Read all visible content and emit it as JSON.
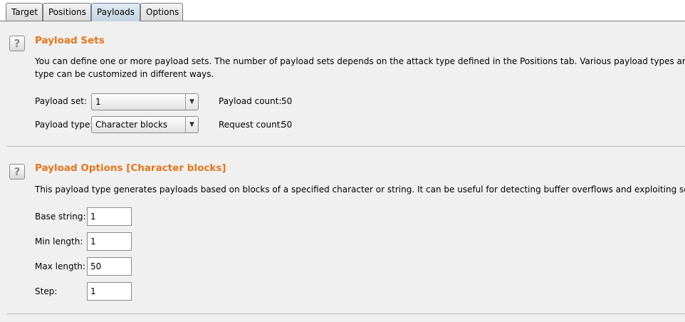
{
  "tabs": [
    {
      "label": "Target"
    },
    {
      "label": "Positions"
    },
    {
      "label": "Payloads"
    },
    {
      "label": "Options"
    }
  ],
  "active_tab": "Payloads",
  "help_icon_glyph": "?",
  "payload_sets": {
    "title": "Payload Sets",
    "desc_line1": "You can define one or more payload sets. The number of payload sets depends on the attack type defined in the Positions tab. Various payload types are available for each",
    "desc_line2": "type can be customized in different ways.",
    "set_label": "Payload set:",
    "set_value": "1",
    "type_label": "Payload type:",
    "type_value": "Character blocks",
    "payload_count_label": "Payload count:",
    "payload_count": "50",
    "request_count_label": "Request count:",
    "request_count": "50"
  },
  "payload_options": {
    "title": "Payload Options [Character blocks]",
    "desc": "This payload type generates payloads based on blocks of a specified character or string. It can be useful for detecting buffer overflows and exploiting some logic flaws.",
    "base_string_label": "Base string:",
    "base_string": "1",
    "min_length_label": "Min length:",
    "min_length": "1",
    "max_length_label": "Max length:",
    "max_length": "50",
    "step_label": "Step:",
    "step": "1"
  },
  "icons": {
    "help": "help-icon",
    "dropdown": "chevron-down-icon"
  }
}
